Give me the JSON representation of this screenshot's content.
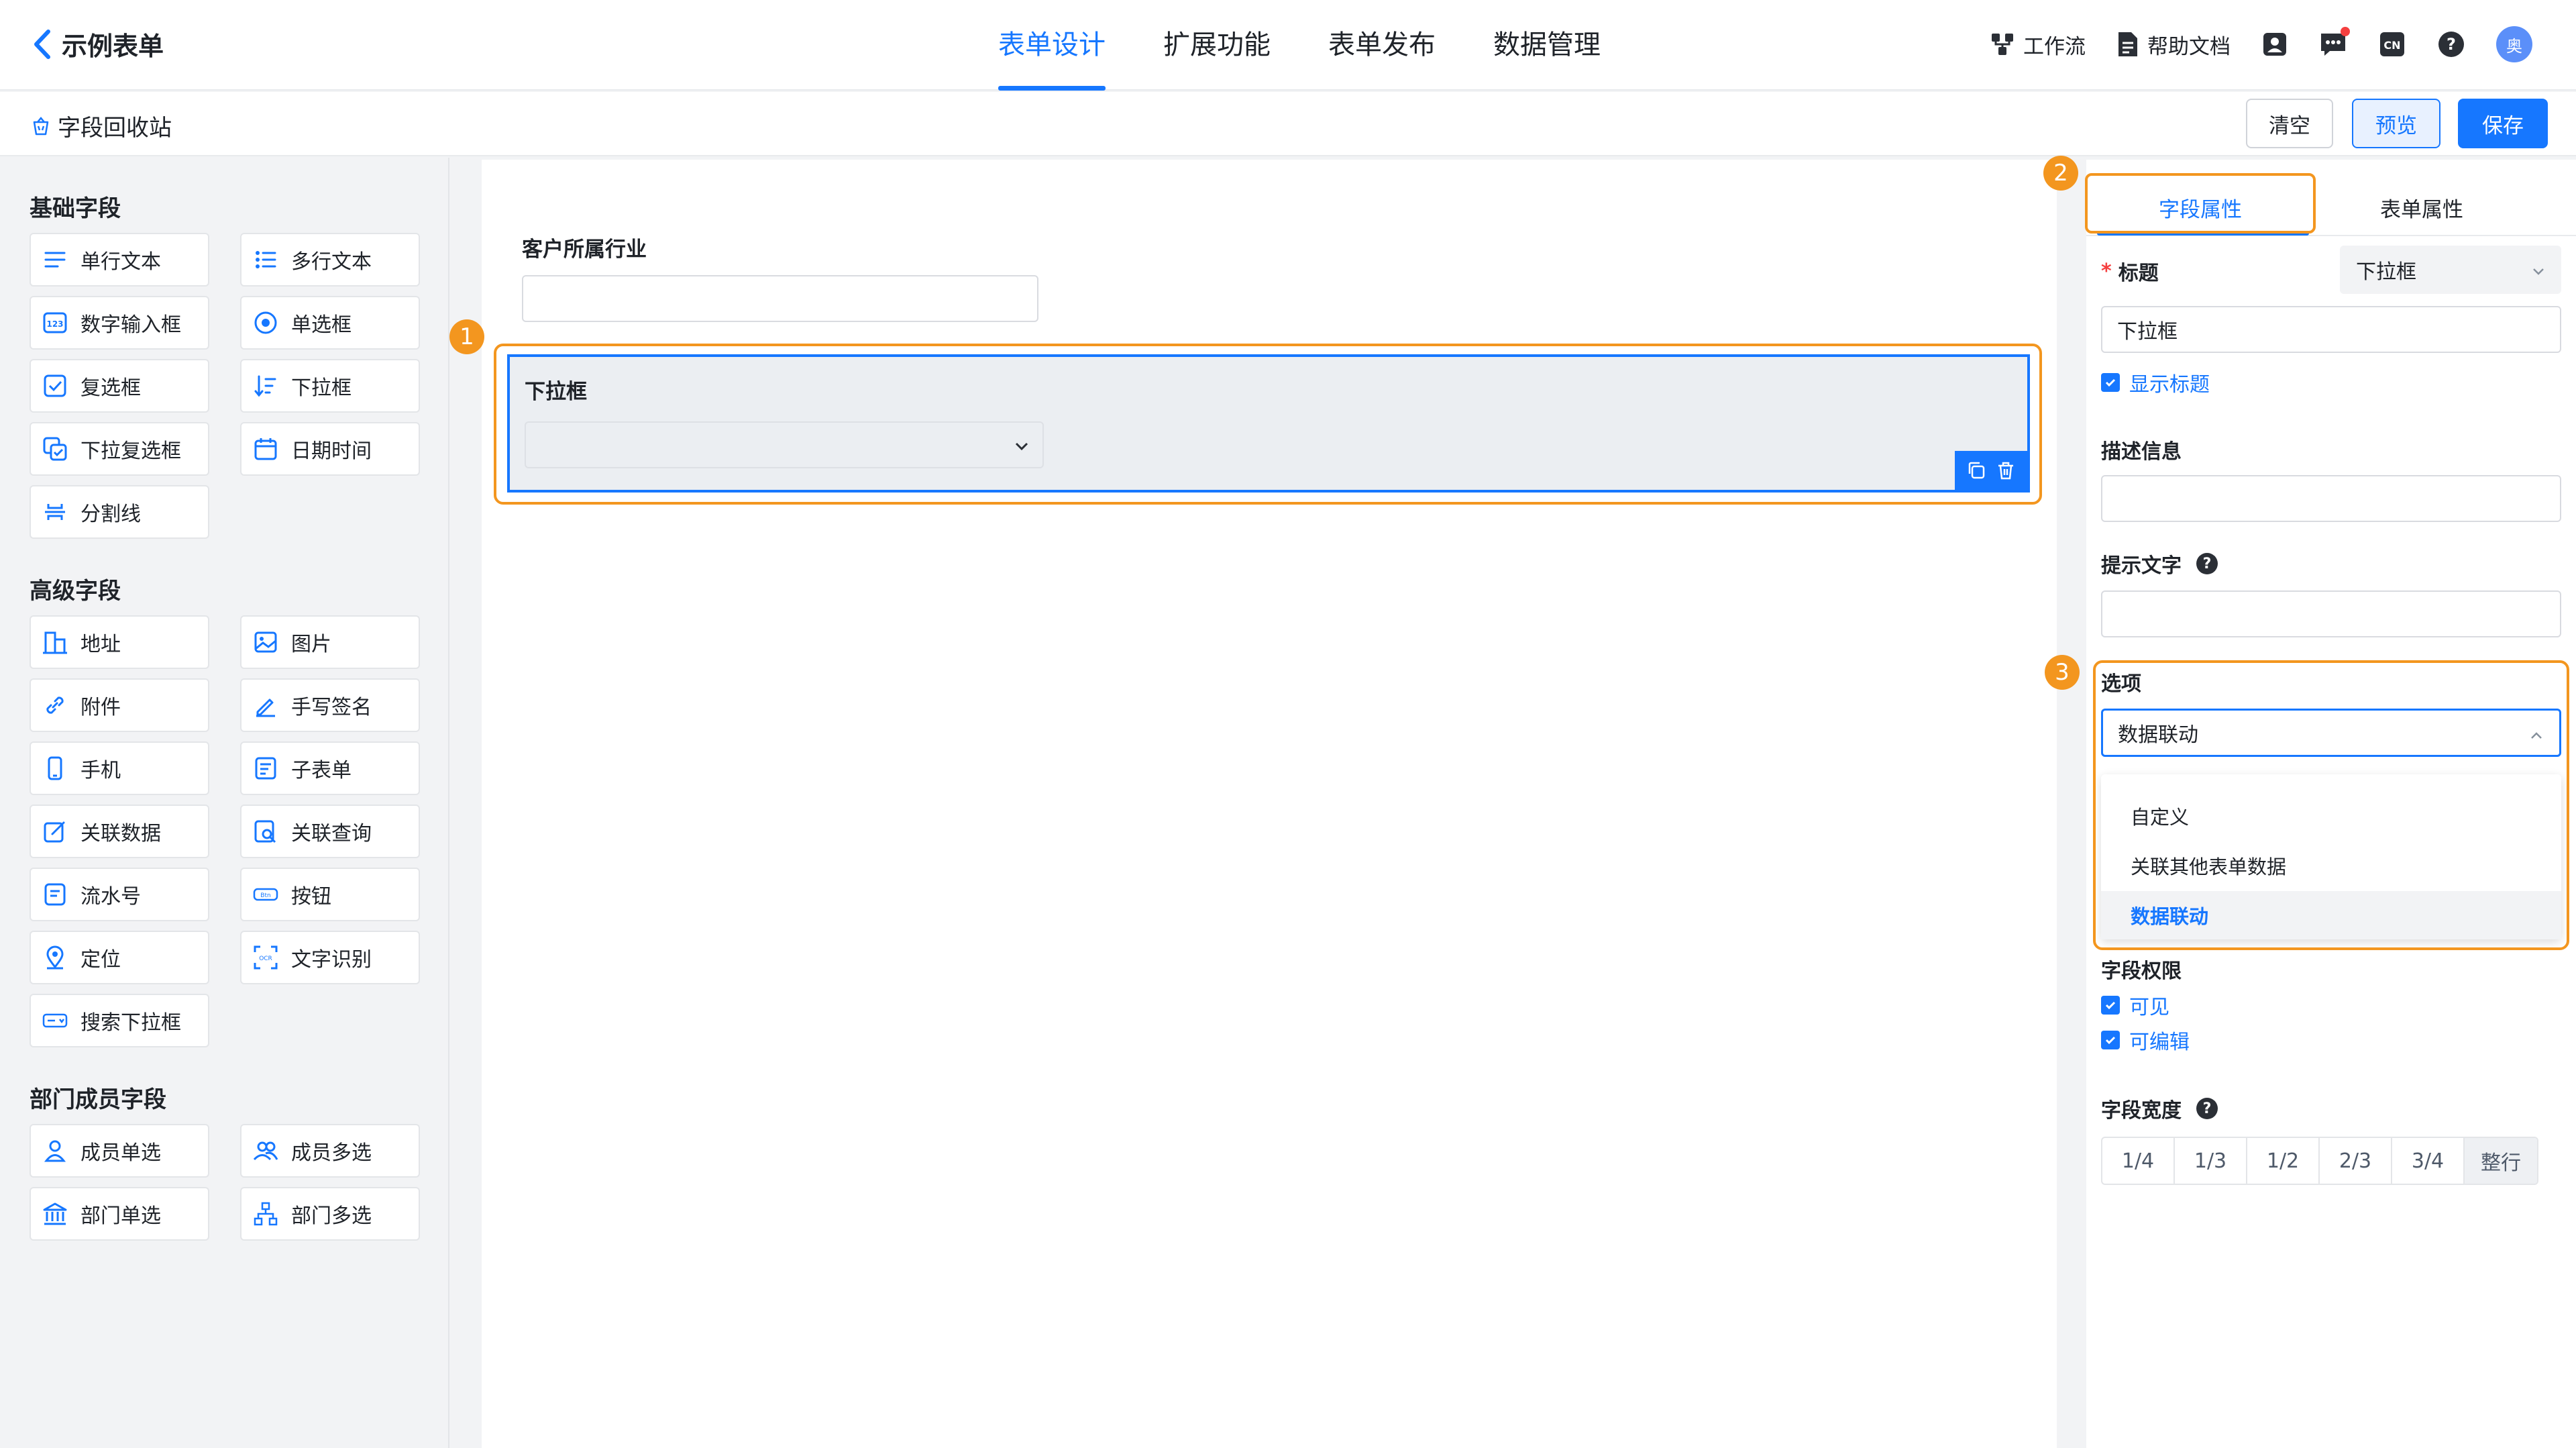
{
  "header": {
    "title": "示例表单",
    "tabs": [
      {
        "label": "表单设计",
        "active": true
      },
      {
        "label": "扩展功能",
        "active": false
      },
      {
        "label": "表单发布",
        "active": false
      },
      {
        "label": "数据管理",
        "active": false
      }
    ],
    "tools": {
      "workflow": "工作流",
      "help_docs": "帮助文档"
    },
    "avatar_text": "奥"
  },
  "toolbar": {
    "recycle_label": "字段回收站",
    "clear_label": "清空",
    "preview_label": "预览",
    "save_label": "保存"
  },
  "left_panel": {
    "basic": {
      "title": "基础字段",
      "items": [
        "单行文本",
        "多行文本",
        "数字输入框",
        "单选框",
        "复选框",
        "下拉框",
        "下拉复选框",
        "日期时间",
        "分割线"
      ]
    },
    "advanced": {
      "title": "高级字段",
      "items": [
        "地址",
        "图片",
        "附件",
        "手写签名",
        "手机",
        "子表单",
        "关联数据",
        "关联查询",
        "流水号",
        "按钮",
        "定位",
        "文字识别",
        "搜索下拉框"
      ]
    },
    "members": {
      "title": "部门成员字段",
      "items": [
        "成员单选",
        "成员多选",
        "部门单选",
        "部门多选"
      ]
    }
  },
  "canvas": {
    "field1_label": "客户所属行业",
    "field2_label": "下拉框"
  },
  "callouts": [
    "1",
    "2",
    "3"
  ],
  "right_panel": {
    "tabs": [
      "字段属性",
      "表单属性"
    ],
    "title_label": "标题",
    "field_type": "下拉框",
    "title_value": "下拉框",
    "show_title": "显示标题",
    "desc_label": "描述信息",
    "hint_label": "提示文字",
    "options_label": "选项",
    "options_value": "数据联动",
    "options_list": [
      "自定义",
      "关联其他表单数据",
      "数据联动"
    ],
    "perm_label": "字段权限",
    "perm_visible": "可见",
    "perm_editable": "可编辑",
    "width_label": "字段宽度",
    "widths": [
      "1/4",
      "1/3",
      "1/2",
      "2/3",
      "3/4",
      "整行"
    ],
    "selected_width": "整行"
  },
  "colors": {
    "accent": "#1677ff",
    "callout": "#f3961f",
    "danger": "#f53f3f"
  }
}
